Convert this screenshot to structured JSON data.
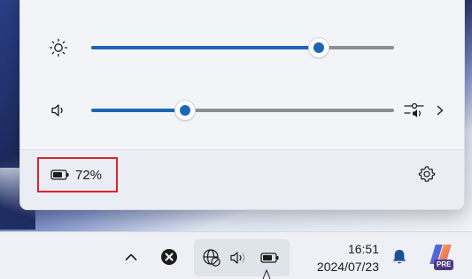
{
  "quick_settings": {
    "brightness": {
      "level_percent": 75,
      "icon": "brightness-icon"
    },
    "volume": {
      "level_percent": 31,
      "icon": "speaker-icon",
      "mixer_icon": "sound-mixer-icon",
      "chevron_icon": "chevron-right-icon"
    },
    "battery": {
      "icon": "battery-icon",
      "label": "72%"
    },
    "settings_icon": "gear-icon"
  },
  "taskbar": {
    "tray": {
      "show_hidden_icon": "chevron-up-icon",
      "app_icon": "close-circle-icon",
      "network_icon": "globe-no-network-icon",
      "volume_icon": "speaker-icon",
      "battery_icon": "battery-icon"
    },
    "clock": {
      "time": "16:51",
      "date": "2024/07/23"
    },
    "notifications_icon": "bell-icon",
    "copilot": {
      "icon": "copilot-icon",
      "badge": "PRE"
    }
  },
  "colors": {
    "accent": "#1e65b7",
    "highlight": "#d9232e"
  }
}
